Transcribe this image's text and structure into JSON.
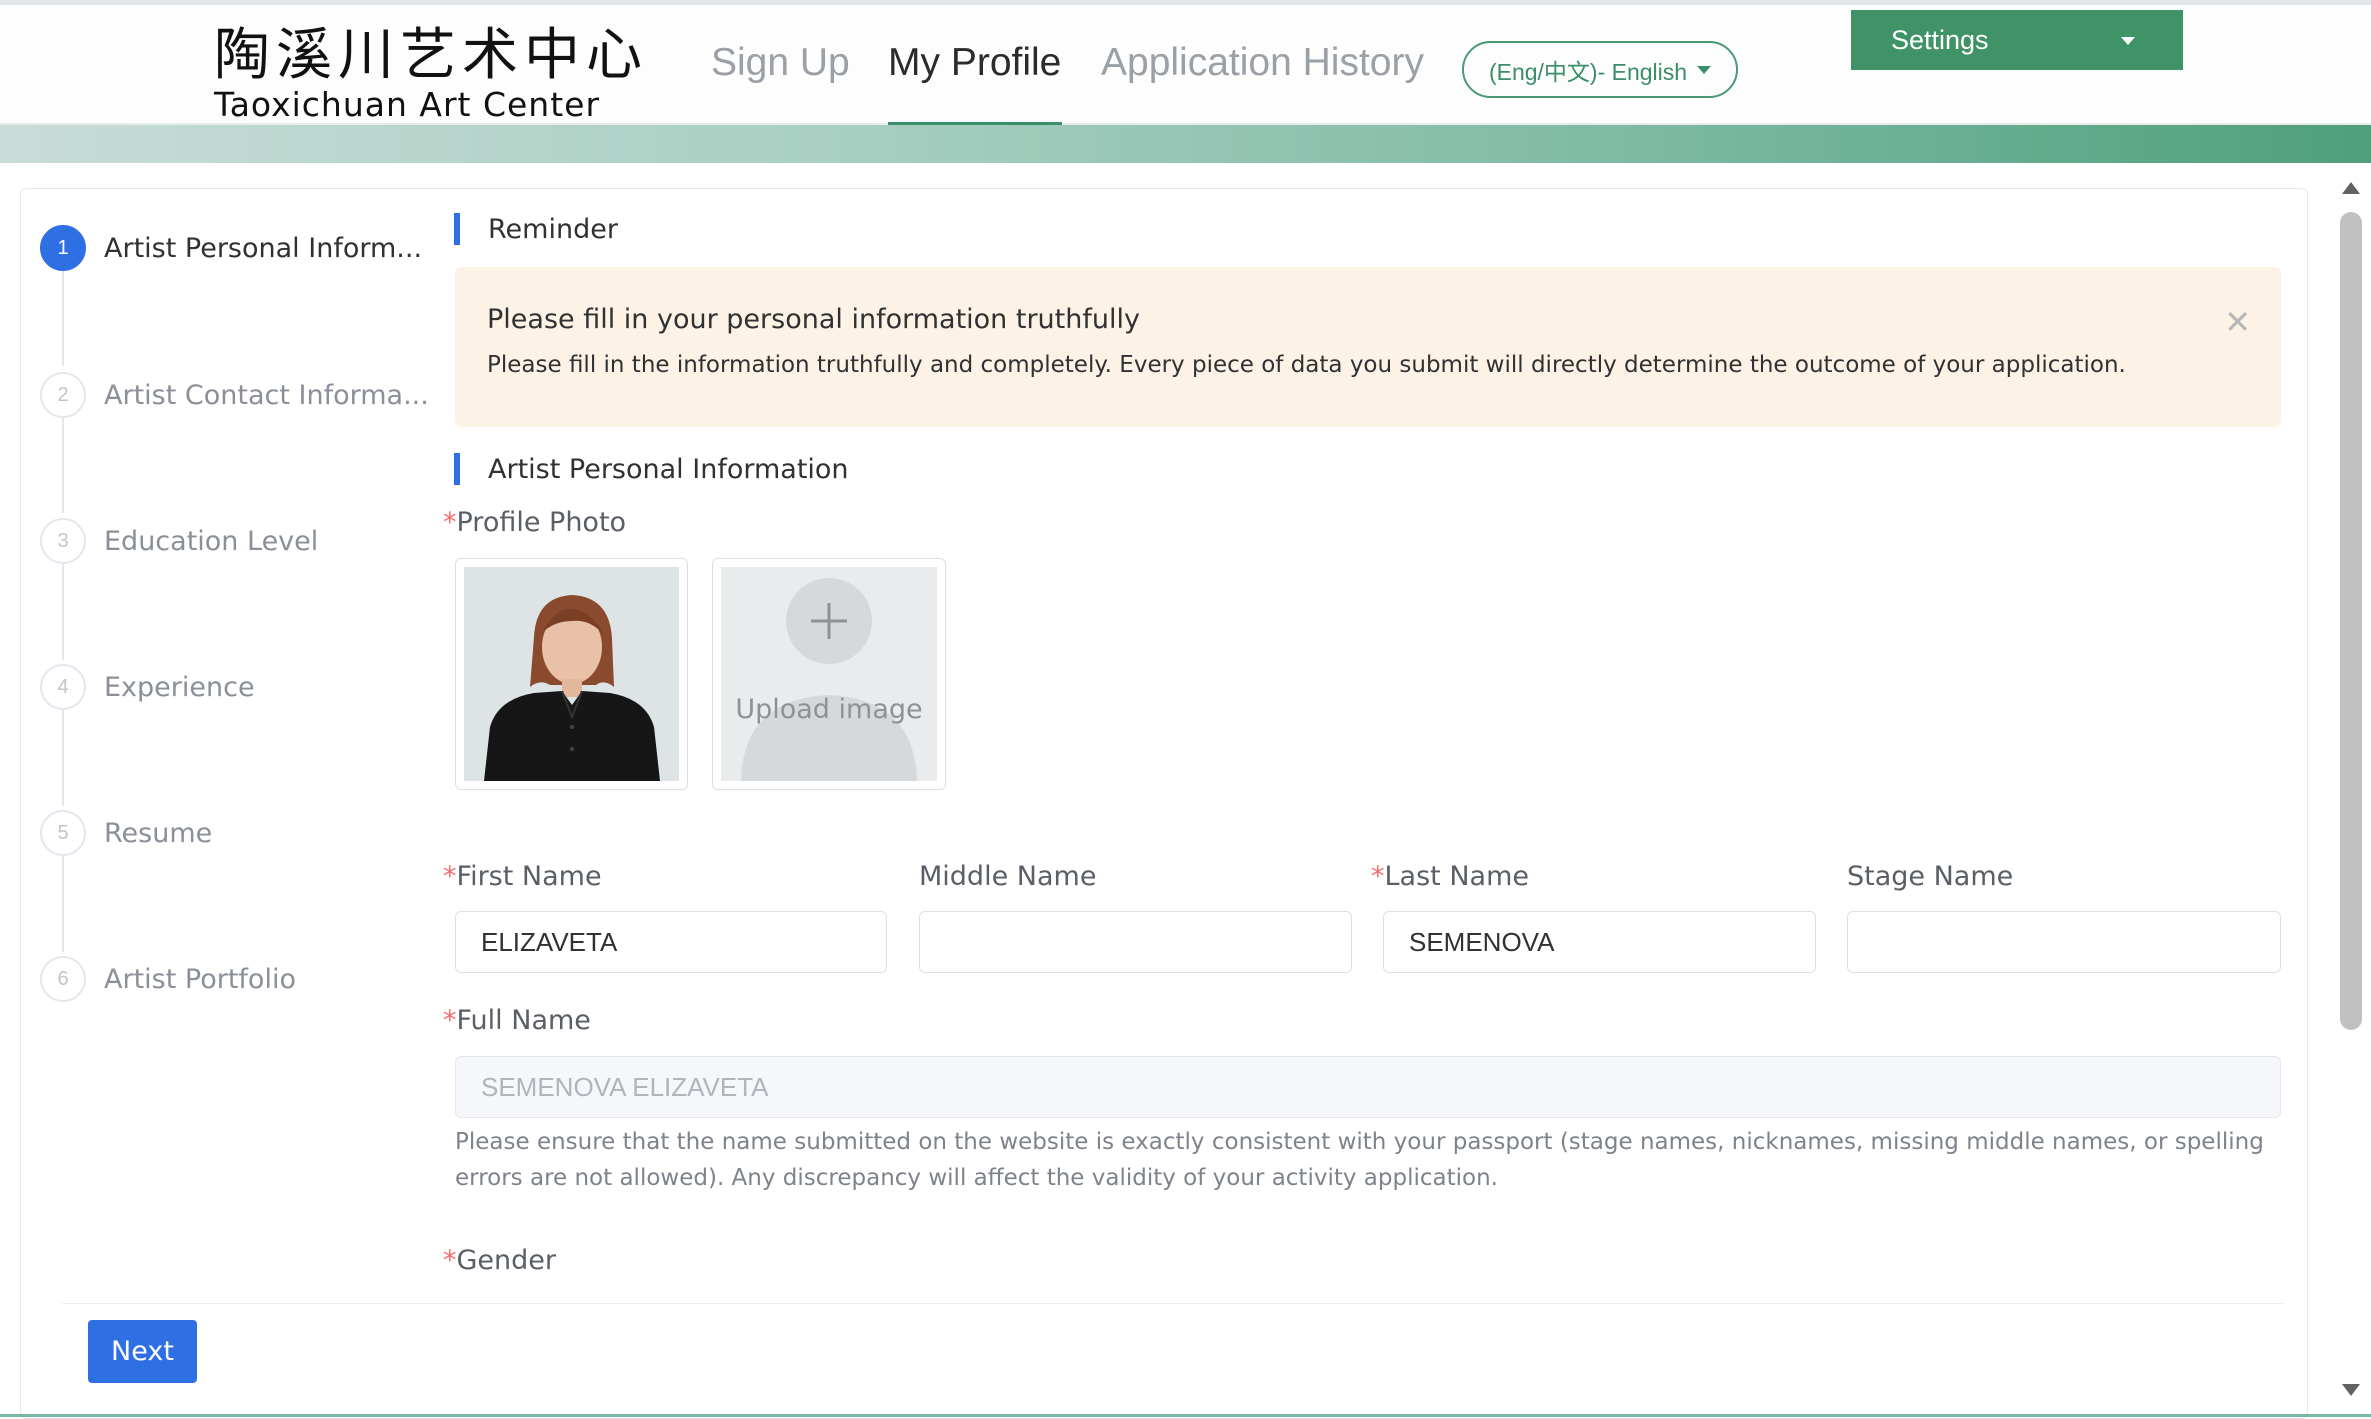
{
  "header": {
    "logo_cn": "陶溪川艺术中心",
    "logo_en": "Taoxichuan Art Center",
    "nav": [
      {
        "label": "Sign Up"
      },
      {
        "label": "My Profile"
      },
      {
        "label": "Application History"
      }
    ],
    "language_label": "(Eng/中文)- English",
    "settings_label": "Settings"
  },
  "steps": [
    {
      "number": "1",
      "label": "Artist Personal Inform..."
    },
    {
      "number": "2",
      "label": "Artist Contact Informa..."
    },
    {
      "number": "3",
      "label": "Education Level"
    },
    {
      "number": "4",
      "label": "Experience"
    },
    {
      "number": "5",
      "label": "Resume"
    },
    {
      "number": "6",
      "label": "Artist Portfolio"
    }
  ],
  "reminder": {
    "section_title": "Reminder",
    "alert_title": "Please fill in your personal information truthfully",
    "alert_desc": "Please fill in the information truthfully and completely. Every piece of data you submit will directly determine the outcome of your application."
  },
  "personal": {
    "section_title": "Artist Personal Information",
    "profile_photo_label": "Profile Photo",
    "upload_label": "Upload image",
    "first_name_label": "First Name",
    "first_name_value": "ELIZAVETA",
    "middle_name_label": "Middle Name",
    "middle_name_value": "",
    "last_name_label": "Last Name",
    "last_name_value": "SEMENOVA",
    "stage_name_label": "Stage Name",
    "stage_name_value": "",
    "full_name_label": "Full Name",
    "full_name_value": "SEMENOVA ELIZAVETA",
    "full_name_hint": "Please ensure that the name submitted on the website is exactly consistent with your passport (stage names, nicknames, missing middle names, or spelling errors are not allowed). Any discrepancy will affect the validity of your activity application.",
    "gender_label": "Gender",
    "required_mark": "*"
  },
  "footer": {
    "next_label": "Next"
  },
  "colors": {
    "brand_green": "#3f9366",
    "primary_blue": "#2f6fe4",
    "alert_bg": "#fdf2e6",
    "required_red": "#f56c6c"
  }
}
